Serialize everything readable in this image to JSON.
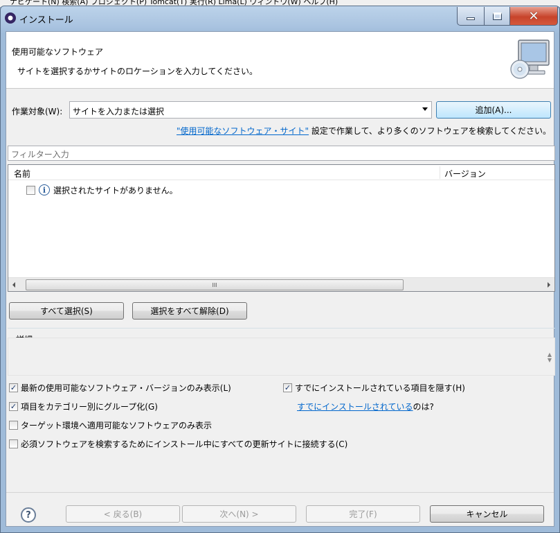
{
  "behind_menu": "ナビゲート(N)  検索(A)  プロジェクト(P)  Tomcat(T)  実行(R)  Lima(L)  ウィンドウ(W)  ヘルプ(H)",
  "window": {
    "title": "インストール",
    "minimize_label": "",
    "maximize_label": "",
    "close_glyph": "✕"
  },
  "banner": {
    "title": "使用可能なソフトウェア",
    "description": "サイトを選択するかサイトのロケーションを入力してください。",
    "image_icon": "computer-cd-icon"
  },
  "work_with": {
    "label": "作業対象(W):",
    "value": "サイトを入力または選択",
    "add_button": "追加(A)..."
  },
  "link_line": {
    "link_text": "\"使用可能なソフトウェア・サイト\"",
    "suffix": " 設定で作業して、より多くのソフトウェアを検索してください。"
  },
  "filter": {
    "placeholder": "フィルター入力"
  },
  "tree": {
    "columns": [
      "名前",
      "バージョン"
    ],
    "rows": [
      {
        "checked": false,
        "icon": "info-icon",
        "name": "選択されたサイトがありません。",
        "version": ""
      }
    ],
    "hscroll_grip": "III"
  },
  "buttons": {
    "select_all": "すべて選択(S)",
    "deselect_all": "選択をすべて解除(D)"
  },
  "details": {
    "label": "詳細"
  },
  "options": {
    "latest_only": {
      "label": "最新の使用可能なソフトウェア・バージョンのみ表示(L)",
      "checked": true
    },
    "hide_installed": {
      "label": "すでにインストールされている項目を隠す(H)",
      "checked": true
    },
    "group_by_category": {
      "label": "項目をカテゴリー別にグループ化(G)",
      "checked": true
    },
    "already_installed_link": "すでにインストールされている",
    "already_installed_suffix": " のは?",
    "target_only": {
      "label": "ターゲット環境へ適用可能なソフトウェアのみ表示",
      "checked": false
    },
    "contact_all": {
      "label": "必須ソフトウェアを検索するためにインストール中にすべての更新サイトに接続する(C)",
      "checked": false
    }
  },
  "footer": {
    "help_glyph": "?",
    "back": "< 戻る(B)",
    "next": "次へ(N) >",
    "finish": "完了(F)",
    "cancel": "キャンセル"
  }
}
